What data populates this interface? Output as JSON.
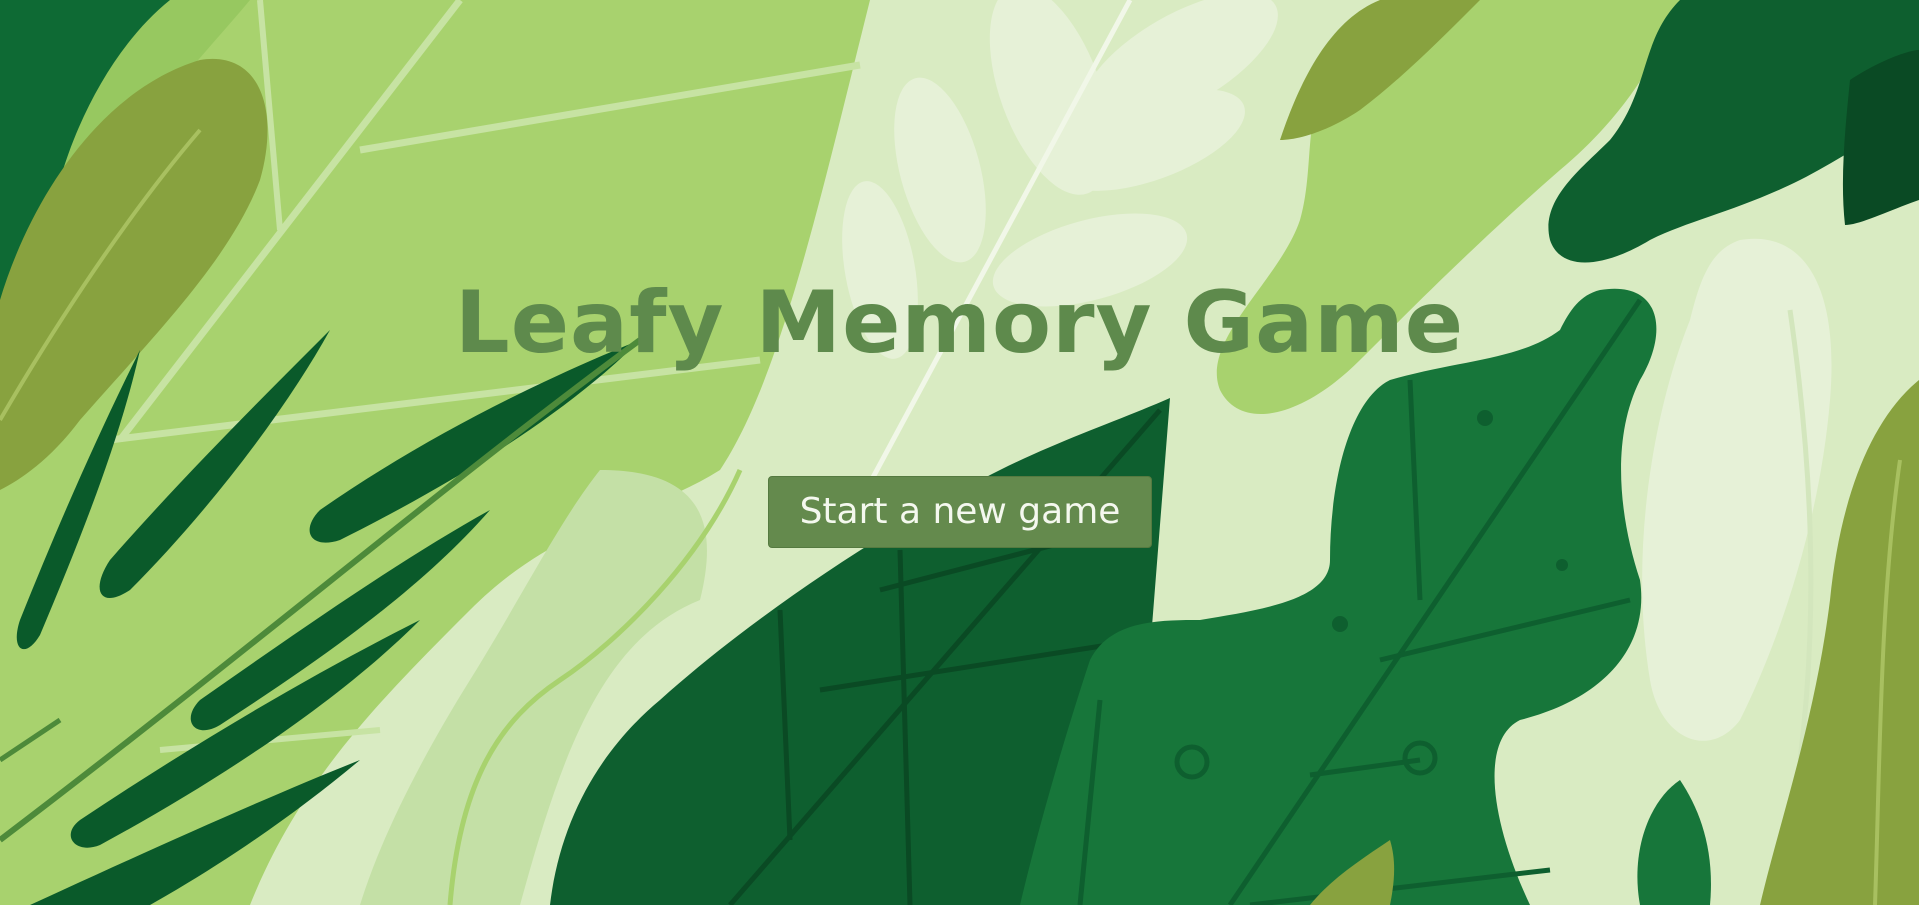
{
  "game": {
    "title": "Leafy Memory Game",
    "start_button_label": "Start a new game"
  },
  "colors": {
    "title_text": "#5e8a4c",
    "button_bg": "#648a4d",
    "button_text": "#f4f8ee",
    "light_green": "#a8d26e",
    "pale_green": "#d9ebc2",
    "dark_green": "#0e5f2f",
    "mid_green": "#17763a",
    "olive": "#88a23f"
  }
}
